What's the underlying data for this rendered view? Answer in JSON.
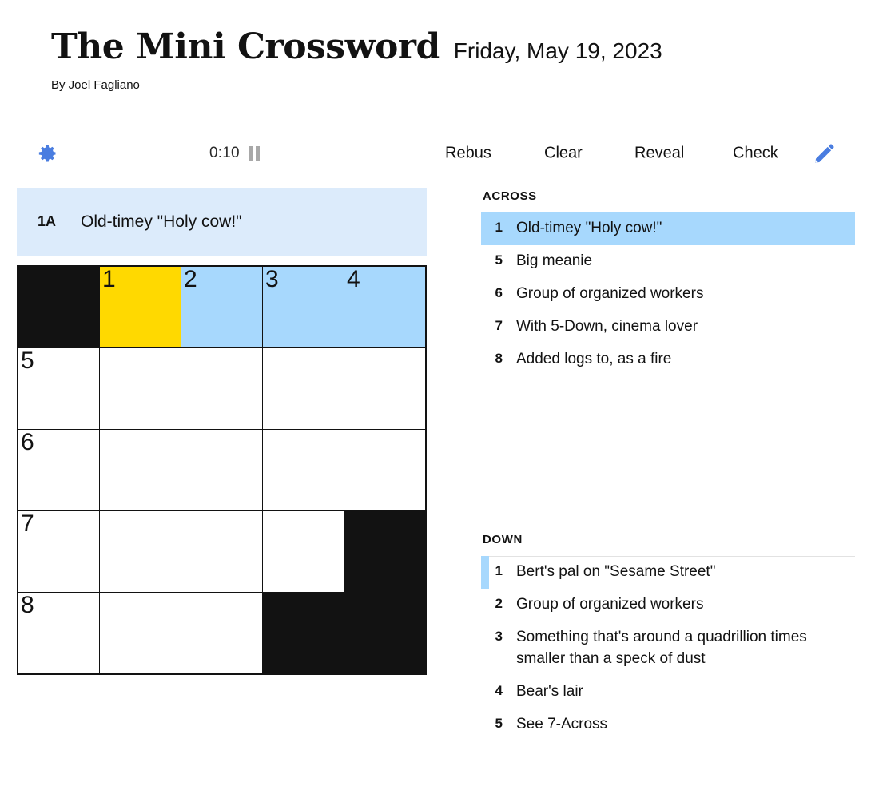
{
  "header": {
    "title": "The Mini Crossword",
    "date": "Friday, May 19, 2023",
    "byline": "By Joel Fagliano"
  },
  "toolbar": {
    "settings_icon": "gear-icon",
    "timer": "0:10",
    "pause_icon": "pause-icon",
    "rebus_label": "Rebus",
    "clear_label": "Clear",
    "reveal_label": "Reveal",
    "check_label": "Check",
    "pencil_icon": "pencil-icon",
    "accent_color": "#4A7DE0"
  },
  "current_clue": {
    "number": "1A",
    "text": "Old-timey \"Holy cow!\"",
    "background": "#DCEBFB"
  },
  "grid": {
    "rows": 5,
    "cols": 5,
    "highlight_color": "#A7D8FD",
    "cursor_color": "#FFD900",
    "block_color": "#121212",
    "cells": [
      [
        {
          "type": "block"
        },
        {
          "type": "cell",
          "number": "1",
          "letter": "",
          "state": "cursor"
        },
        {
          "type": "cell",
          "number": "2",
          "letter": "",
          "state": "highlight"
        },
        {
          "type": "cell",
          "number": "3",
          "letter": "",
          "state": "highlight"
        },
        {
          "type": "cell",
          "number": "4",
          "letter": "",
          "state": "highlight"
        }
      ],
      [
        {
          "type": "cell",
          "number": "5",
          "letter": "",
          "state": "normal"
        },
        {
          "type": "cell",
          "number": "",
          "letter": "",
          "state": "normal"
        },
        {
          "type": "cell",
          "number": "",
          "letter": "",
          "state": "normal"
        },
        {
          "type": "cell",
          "number": "",
          "letter": "",
          "state": "normal"
        },
        {
          "type": "cell",
          "number": "",
          "letter": "",
          "state": "normal"
        }
      ],
      [
        {
          "type": "cell",
          "number": "6",
          "letter": "",
          "state": "normal"
        },
        {
          "type": "cell",
          "number": "",
          "letter": "",
          "state": "normal"
        },
        {
          "type": "cell",
          "number": "",
          "letter": "",
          "state": "normal"
        },
        {
          "type": "cell",
          "number": "",
          "letter": "",
          "state": "normal"
        },
        {
          "type": "cell",
          "number": "",
          "letter": "",
          "state": "normal"
        }
      ],
      [
        {
          "type": "cell",
          "number": "7",
          "letter": "",
          "state": "normal"
        },
        {
          "type": "cell",
          "number": "",
          "letter": "",
          "state": "normal"
        },
        {
          "type": "cell",
          "number": "",
          "letter": "",
          "state": "normal"
        },
        {
          "type": "cell",
          "number": "",
          "letter": "",
          "state": "normal"
        },
        {
          "type": "block"
        }
      ],
      [
        {
          "type": "cell",
          "number": "8",
          "letter": "",
          "state": "normal"
        },
        {
          "type": "cell",
          "number": "",
          "letter": "",
          "state": "normal"
        },
        {
          "type": "cell",
          "number": "",
          "letter": "",
          "state": "normal"
        },
        {
          "type": "block"
        },
        {
          "type": "block"
        }
      ]
    ]
  },
  "clues": {
    "across_title": "ACROSS",
    "down_title": "DOWN",
    "across": [
      {
        "number": "1",
        "text": "Old-timey \"Holy cow!\"",
        "active": true,
        "bar": false,
        "topline": false
      },
      {
        "number": "5",
        "text": "Big meanie",
        "active": false,
        "bar": false,
        "topline": false
      },
      {
        "number": "6",
        "text": "Group of organized workers",
        "active": false,
        "bar": false,
        "topline": false
      },
      {
        "number": "7",
        "text": "With 5-Down, cinema lover",
        "active": false,
        "bar": false,
        "topline": false
      },
      {
        "number": "8",
        "text": "Added logs to, as a fire",
        "active": false,
        "bar": false,
        "topline": false
      }
    ],
    "down": [
      {
        "number": "1",
        "text": "Bert's pal on \"Sesame Street\"",
        "active": false,
        "bar": true,
        "topline": true
      },
      {
        "number": "2",
        "text": "Group of organized workers",
        "active": false,
        "bar": false,
        "topline": false
      },
      {
        "number": "3",
        "text": "Something that's around a quadrillion times smaller than a speck of dust",
        "active": false,
        "bar": false,
        "topline": false
      },
      {
        "number": "4",
        "text": "Bear's lair",
        "active": false,
        "bar": false,
        "topline": false
      },
      {
        "number": "5",
        "text": "See 7-Across",
        "active": false,
        "bar": false,
        "topline": false
      }
    ]
  }
}
